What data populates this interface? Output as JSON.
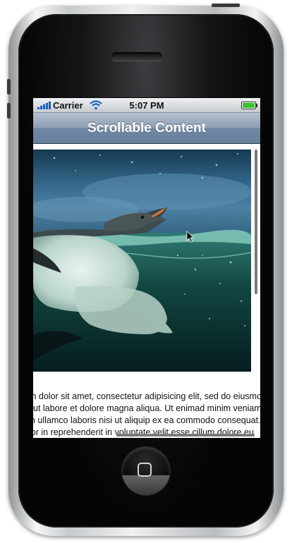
{
  "status_bar": {
    "carrier": "Carrier",
    "time": "5:07 PM",
    "signal_icon": "signal-bars-icon",
    "wifi_icon": "wifi-icon",
    "battery_icon": "battery-icon",
    "battery_color": "#39c22c"
  },
  "nav_bar": {
    "title": "Scrollable Content",
    "gradient_top": "#b7c2d0",
    "gradient_bottom": "#6a819d"
  },
  "content": {
    "image_subject": "penguin-photo",
    "text_lines": [
      "m dolor sit amet, consectetur adipisicing elit, sed do eiusmod tempor",
      "ut labore et dolore magna aliqua. Ut enimad minim veniam, quis",
      "n ullamco laboris nisi ut aliquip ex ea commodo consequat.",
      "lor in reprehenderit in voluptate velit esse cillum dolore eu"
    ]
  },
  "device": {
    "home_button_icon": "home-square-icon"
  }
}
